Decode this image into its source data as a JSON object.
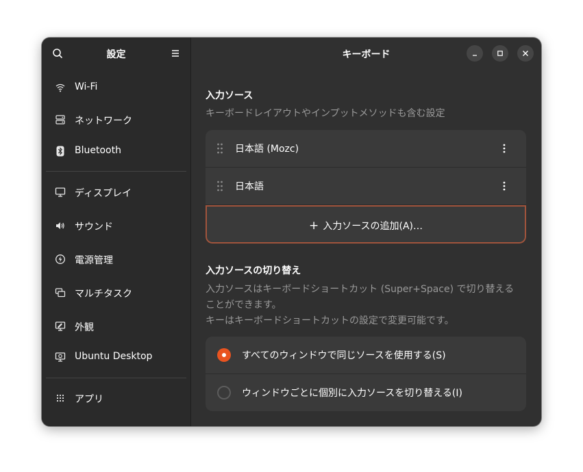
{
  "sidebar": {
    "title": "設定",
    "items": [
      {
        "label": "Wi-Fi",
        "icon": "wifi-icon"
      },
      {
        "label": "ネットワーク",
        "icon": "network-icon"
      },
      {
        "label": "Bluetooth",
        "icon": "bluetooth-icon"
      },
      {
        "label": "ディスプレイ",
        "icon": "display-icon"
      },
      {
        "label": "サウンド",
        "icon": "sound-icon"
      },
      {
        "label": "電源管理",
        "icon": "power-icon"
      },
      {
        "label": "マルチタスク",
        "icon": "multitasking-icon"
      },
      {
        "label": "外観",
        "icon": "appearance-icon"
      },
      {
        "label": "Ubuntu Desktop",
        "icon": "ubuntu-desktop-icon"
      },
      {
        "label": "アプリ",
        "icon": "apps-icon"
      }
    ]
  },
  "header": {
    "title": "キーボード"
  },
  "input_sources": {
    "title": "入力ソース",
    "subtitle": "キーボードレイアウトやインプットメソッドも含む設定",
    "sources": [
      {
        "label": "日本語 (Mozc)"
      },
      {
        "label": "日本語"
      }
    ],
    "add_label": "入力ソースの追加(A)…"
  },
  "switching": {
    "title": "入力ソースの切り替え",
    "desc_line1": "入力ソースはキーボードショートカット (Super+Space) で切り替える",
    "desc_line2": "ことができます。",
    "desc_line3": "キーはキーボードショートカットの設定で変更可能です。",
    "options": [
      {
        "label": "すべてのウィンドウで同じソースを使用する(S)",
        "selected": true
      },
      {
        "label": "ウィンドウごとに個別に入力ソースを切り替える(I)",
        "selected": false
      }
    ]
  },
  "colors": {
    "accent": "#e95420",
    "focus_border": "#a1543c",
    "window_bg": "#303030",
    "sidebar_bg": "#2a2a2a",
    "row_bg": "#3a3a3a"
  }
}
